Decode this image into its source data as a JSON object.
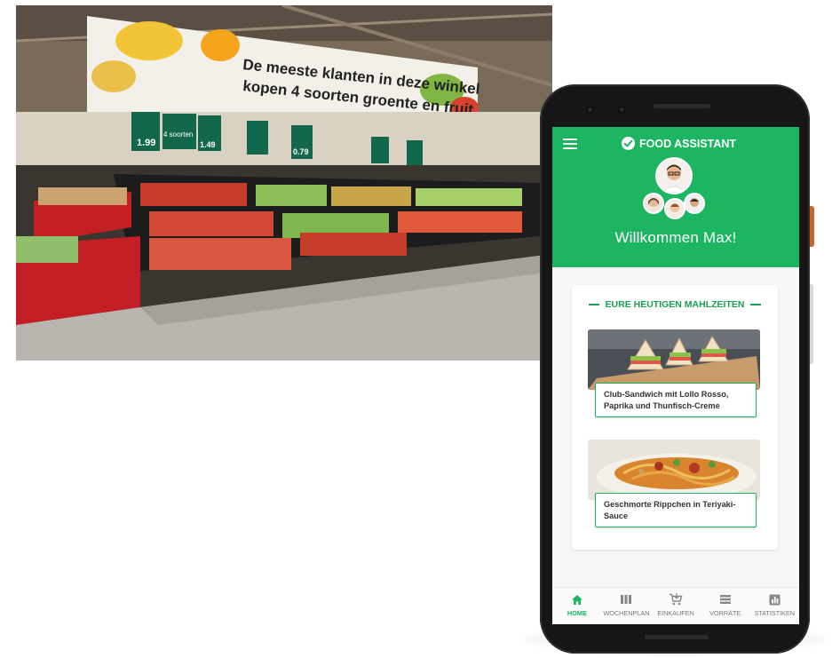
{
  "photo": {
    "banner_line1": "De meeste klanten in deze winkel",
    "banner_line2": "kopen 4 soorten groente en fruit.",
    "sign_banner": "4 soorten",
    "prices": [
      "1.99",
      "0.79",
      "1.49"
    ]
  },
  "app": {
    "brand": "FOOD ASSISTANT",
    "welcome": "Willkommen Max!",
    "section_title": "EURE HEUTIGEN MAHLZEITEN",
    "meals": [
      {
        "name": "Club-Sandwich mit Lollo Rosso, Paprika und Thunfisch-Creme"
      },
      {
        "name": "Geschmorte Rippchen in Teriyaki-Sauce"
      }
    ],
    "nav": [
      {
        "label": "HOME",
        "icon": "home-icon",
        "active": true
      },
      {
        "label": "WOCHENPLAN",
        "icon": "calendar-columns-icon",
        "active": false
      },
      {
        "label": "EINKAUFEN",
        "icon": "shopping-cart-icon",
        "active": false
      },
      {
        "label": "VORRÄTE",
        "icon": "list-icon",
        "active": false
      },
      {
        "label": "STATISTIKEN",
        "icon": "bar-chart-icon",
        "active": false
      }
    ]
  },
  "colors": {
    "accent": "#1db562",
    "accent_dark": "#1a9f57",
    "phone_body": "#161616"
  }
}
